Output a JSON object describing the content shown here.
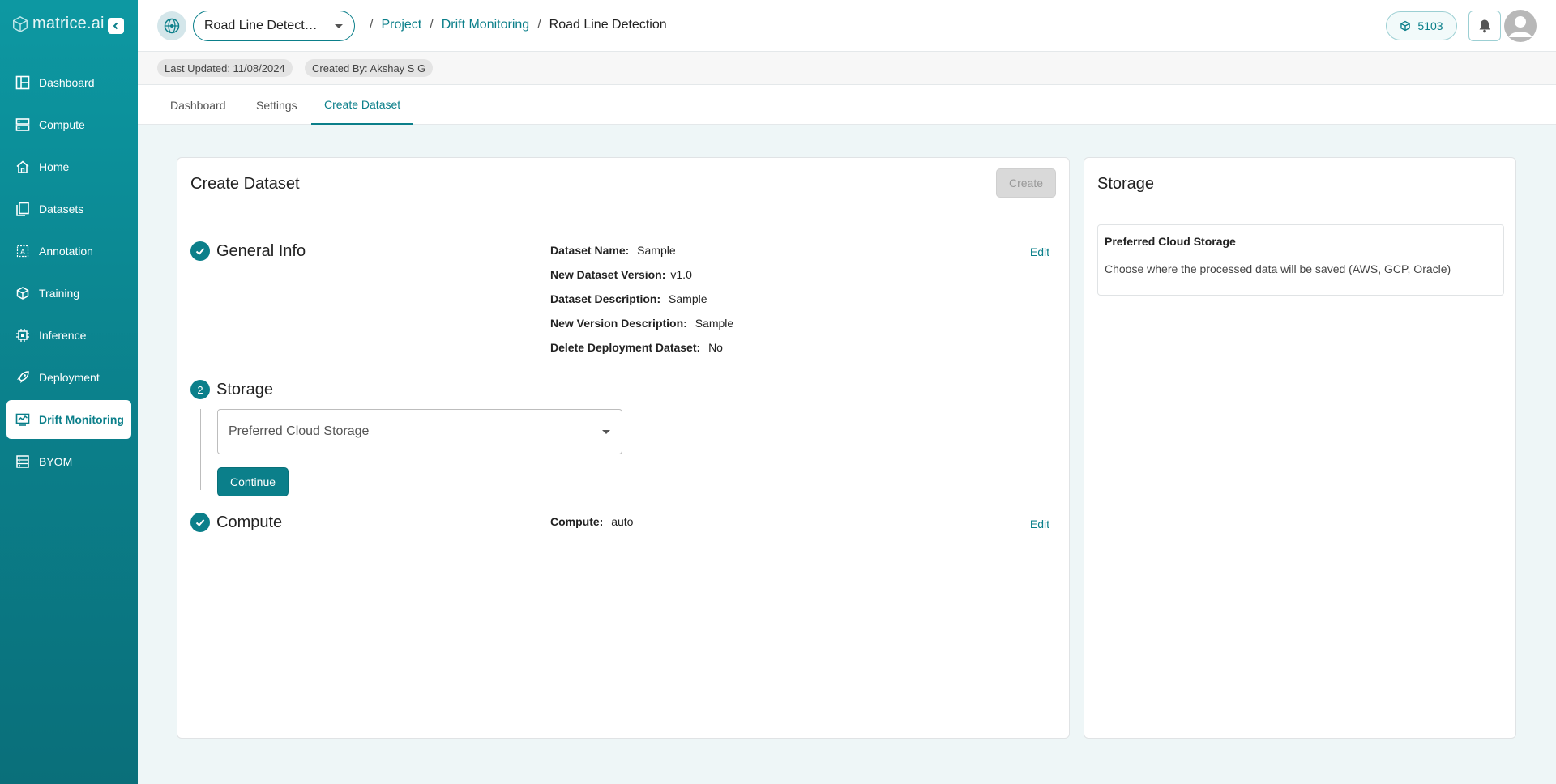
{
  "brand": {
    "name": "matrice.ai"
  },
  "sidebar": {
    "items": [
      {
        "label": "Dashboard",
        "icon": "dashboard-icon"
      },
      {
        "label": "Compute",
        "icon": "server-icon"
      },
      {
        "label": "Home",
        "icon": "home-icon"
      },
      {
        "label": "Datasets",
        "icon": "files-icon"
      },
      {
        "label": "Annotation",
        "icon": "annotation-icon"
      },
      {
        "label": "Training",
        "icon": "cube-icon"
      },
      {
        "label": "Inference",
        "icon": "chip-icon"
      },
      {
        "label": "Deployment",
        "icon": "rocket-icon"
      },
      {
        "label": "Drift Monitoring",
        "icon": "monitor-icon",
        "active": true
      },
      {
        "label": "BYOM",
        "icon": "models-icon"
      }
    ]
  },
  "header": {
    "project_select": "Road Line Detect…",
    "breadcrumb": [
      "Project",
      "Drift Monitoring",
      "Road Line Detection"
    ],
    "credits": "5103"
  },
  "meta": {
    "last_updated": "Last Updated: 11/08/2024",
    "created_by": "Created By: Akshay S G"
  },
  "tabs": [
    "Dashboard",
    "Settings",
    "Create Dataset"
  ],
  "main": {
    "title": "Create Dataset",
    "create_label": "Create",
    "steps": {
      "general": {
        "title": "General Info",
        "edit": "Edit",
        "fields": [
          {
            "key": "Dataset Name:",
            "value": "Sample"
          },
          {
            "key": "New Dataset Version:",
            "value": "v1.0"
          },
          {
            "key": "Dataset Description:",
            "value": "Sample"
          },
          {
            "key": "New Version Description:",
            "value": "Sample"
          },
          {
            "key": "Delete Deployment Dataset:",
            "value": "No"
          }
        ]
      },
      "storage": {
        "number": "2",
        "title": "Storage",
        "placeholder": "Preferred Cloud Storage",
        "continue_label": "Continue"
      },
      "compute": {
        "title": "Compute",
        "edit": "Edit",
        "key": "Compute:",
        "value": "auto"
      }
    }
  },
  "side": {
    "title": "Storage",
    "info_title": "Preferred Cloud Storage",
    "info_desc": "Choose where the processed data will be saved (AWS, GCP, Oracle)"
  },
  "colors": {
    "accent": "#0b7f8a",
    "sidebar": "#0d98a2"
  }
}
